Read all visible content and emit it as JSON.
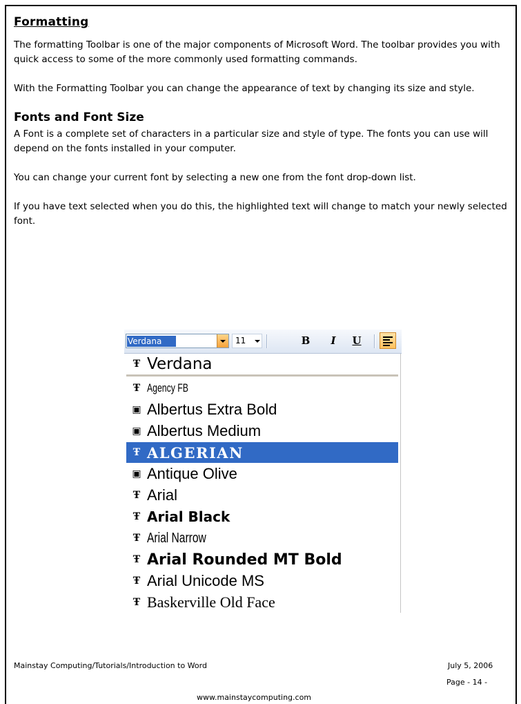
{
  "section1": {
    "heading": "Formatting",
    "para1": "The formatting Toolbar is one of the major components of Microsoft Word.  The toolbar provides you with quick access to some of the more commonly used formatting commands.",
    "para2": "With the Formatting Toolbar you can change the appearance of text by changing its size and style."
  },
  "section2": {
    "heading": "Fonts and Font Size",
    "para1": "A Font is a complete set of characters in a particular size and style of type.  The fonts you can use will depend on the fonts installed in your computer.",
    "para2": "You can change your current font by selecting a new one from the font drop-down list.",
    "para3": "If you have text selected when you do this, the highlighted text will change to match your newly selected font."
  },
  "toolbar": {
    "font_value": "Verdana",
    "size_value": "11",
    "bold_label": "B",
    "italic_label": "I",
    "underline_label": "U",
    "align_icon": "align-left-icon"
  },
  "font_list": [
    {
      "label": "Verdana",
      "icon": "truetype-icon",
      "glyph": "Ŧ"
    },
    {
      "label": "Agency FB",
      "icon": "truetype-icon",
      "glyph": "Ŧ"
    },
    {
      "label": "Albertus Extra Bold",
      "icon": "printer-font-icon",
      "glyph": "▣"
    },
    {
      "label": "Albertus Medium",
      "icon": "printer-font-icon",
      "glyph": "▣"
    },
    {
      "label": "ALGERIAN",
      "icon": "truetype-icon",
      "glyph": "Ŧ"
    },
    {
      "label": "Antique Olive",
      "icon": "printer-font-icon",
      "glyph": "▣"
    },
    {
      "label": "Arial",
      "icon": "truetype-icon",
      "glyph": "Ŧ"
    },
    {
      "label": "Arial Black",
      "icon": "truetype-icon",
      "glyph": "Ŧ"
    },
    {
      "label": "Arial Narrow",
      "icon": "truetype-icon",
      "glyph": "Ŧ"
    },
    {
      "label": "Arial Rounded MT Bold",
      "icon": "truetype-icon",
      "glyph": "Ŧ"
    },
    {
      "label": "Arial Unicode MS",
      "icon": "truetype-icon",
      "glyph": "Ŧ"
    },
    {
      "label": "Baskerville Old Face",
      "icon": "truetype-icon",
      "glyph": "Ŧ"
    }
  ],
  "selected_font": "ALGERIAN",
  "footer": {
    "path": "Mainstay Computing/Tutorials/Introduction to Word",
    "date": "July 5, 2006",
    "page": "Page  - 14 -",
    "url": "www.mainstaycomputing.com"
  },
  "colors": {
    "selection": "#316ac5",
    "dropdown_button": "#f7a23a"
  }
}
